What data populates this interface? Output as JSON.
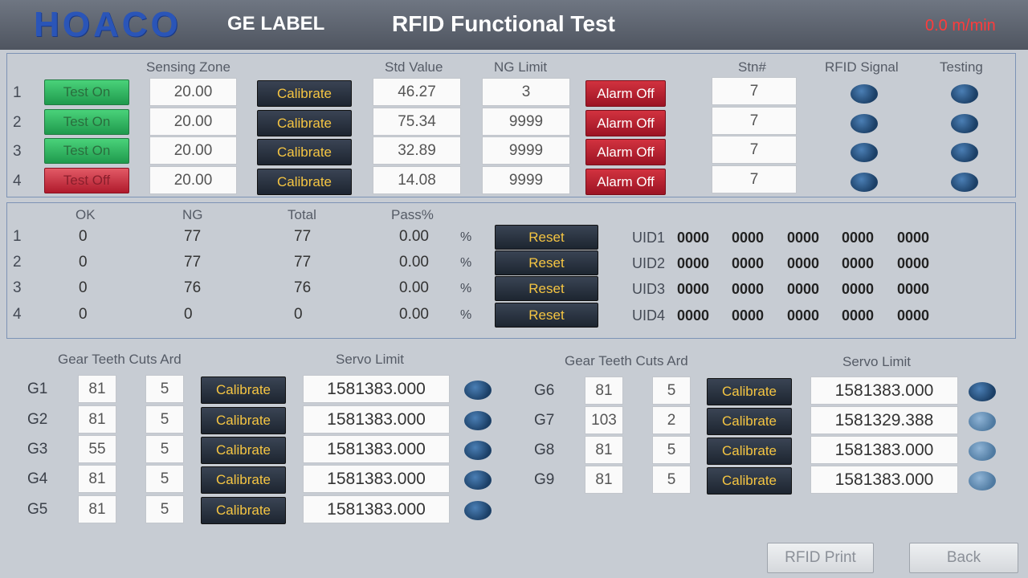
{
  "header": {
    "logo": "HOACO",
    "brand": "GE LABEL",
    "title": "RFID Functional Test",
    "speed": "0.0 m/min"
  },
  "sensing": {
    "headers": {
      "sensing_zone": "Sensing Zone",
      "std_value": "Std Value",
      "ng_limit": "NG Limit",
      "stn": "Stn#",
      "rfid_signal": "RFID Signal",
      "testing": "Testing"
    },
    "rows": [
      {
        "num": "1",
        "test": "Test On",
        "zone": "20.00",
        "calibrate": "Calibrate",
        "std": "46.27",
        "ng": "3",
        "alarm": "Alarm Off",
        "stn": "7"
      },
      {
        "num": "2",
        "test": "Test On",
        "zone": "20.00",
        "calibrate": "Calibrate",
        "std": "75.34",
        "ng": "9999",
        "alarm": "Alarm Off",
        "stn": "7"
      },
      {
        "num": "3",
        "test": "Test On",
        "zone": "20.00",
        "calibrate": "Calibrate",
        "std": "32.89",
        "ng": "9999",
        "alarm": "Alarm Off",
        "stn": "7"
      },
      {
        "num": "4",
        "test": "Test Off",
        "zone": "20.00",
        "calibrate": "Calibrate",
        "std": "14.08",
        "ng": "9999",
        "alarm": "Alarm Off",
        "stn": "7"
      }
    ]
  },
  "stats": {
    "headers": {
      "ok": "OK",
      "ng": "NG",
      "total": "Total",
      "pass": "Pass%"
    },
    "rows": [
      {
        "num": "1",
        "ok": "0",
        "ng": "77",
        "total": "77",
        "pass": "0.00",
        "pct": "%",
        "reset": "Reset",
        "uid_label": "UID1",
        "uids": [
          "0000",
          "0000",
          "0000",
          "0000",
          "0000"
        ]
      },
      {
        "num": "2",
        "ok": "0",
        "ng": "77",
        "total": "77",
        "pass": "0.00",
        "pct": "%",
        "reset": "Reset",
        "uid_label": "UID2",
        "uids": [
          "0000",
          "0000",
          "0000",
          "0000",
          "0000"
        ]
      },
      {
        "num": "3",
        "ok": "0",
        "ng": "76",
        "total": "76",
        "pass": "0.00",
        "pct": "%",
        "reset": "Reset",
        "uid_label": "UID3",
        "uids": [
          "0000",
          "0000",
          "0000",
          "0000",
          "0000"
        ]
      },
      {
        "num": "4",
        "ok": "0",
        "ng": "0",
        "total": "0",
        "pass": "0.00",
        "pct": "%",
        "reset": "Reset",
        "uid_label": "UID4",
        "uids": [
          "0000",
          "0000",
          "0000",
          "0000",
          "0000"
        ]
      }
    ]
  },
  "gears": {
    "headers": {
      "teeth": "Gear Teeth Cuts Ard",
      "servo": "Servo Limit"
    },
    "left": [
      {
        "label": "G1",
        "teeth": "81",
        "cuts": "5",
        "calibrate": "Calibrate",
        "servo": "1581383.000"
      },
      {
        "label": "G2",
        "teeth": "81",
        "cuts": "5",
        "calibrate": "Calibrate",
        "servo": "1581383.000"
      },
      {
        "label": "G3",
        "teeth": "55",
        "cuts": "5",
        "calibrate": "Calibrate",
        "servo": "1581383.000"
      },
      {
        "label": "G4",
        "teeth": "81",
        "cuts": "5",
        "calibrate": "Calibrate",
        "servo": "1581383.000"
      },
      {
        "label": "G5",
        "teeth": "81",
        "cuts": "5",
        "calibrate": "Calibrate",
        "servo": "1581383.000"
      }
    ],
    "right": [
      {
        "label": "G6",
        "teeth": "81",
        "cuts": "5",
        "calibrate": "Calibrate",
        "servo": "1581383.000"
      },
      {
        "label": "G7",
        "teeth": "103",
        "cuts": "2",
        "calibrate": "Calibrate",
        "servo": "1581329.388"
      },
      {
        "label": "G8",
        "teeth": "81",
        "cuts": "5",
        "calibrate": "Calibrate",
        "servo": "1581383.000"
      },
      {
        "label": "G9",
        "teeth": "81",
        "cuts": "5",
        "calibrate": "Calibrate",
        "servo": "1581383.000"
      }
    ]
  },
  "footer": {
    "rfid_print": "RFID Print",
    "back": "Back"
  }
}
